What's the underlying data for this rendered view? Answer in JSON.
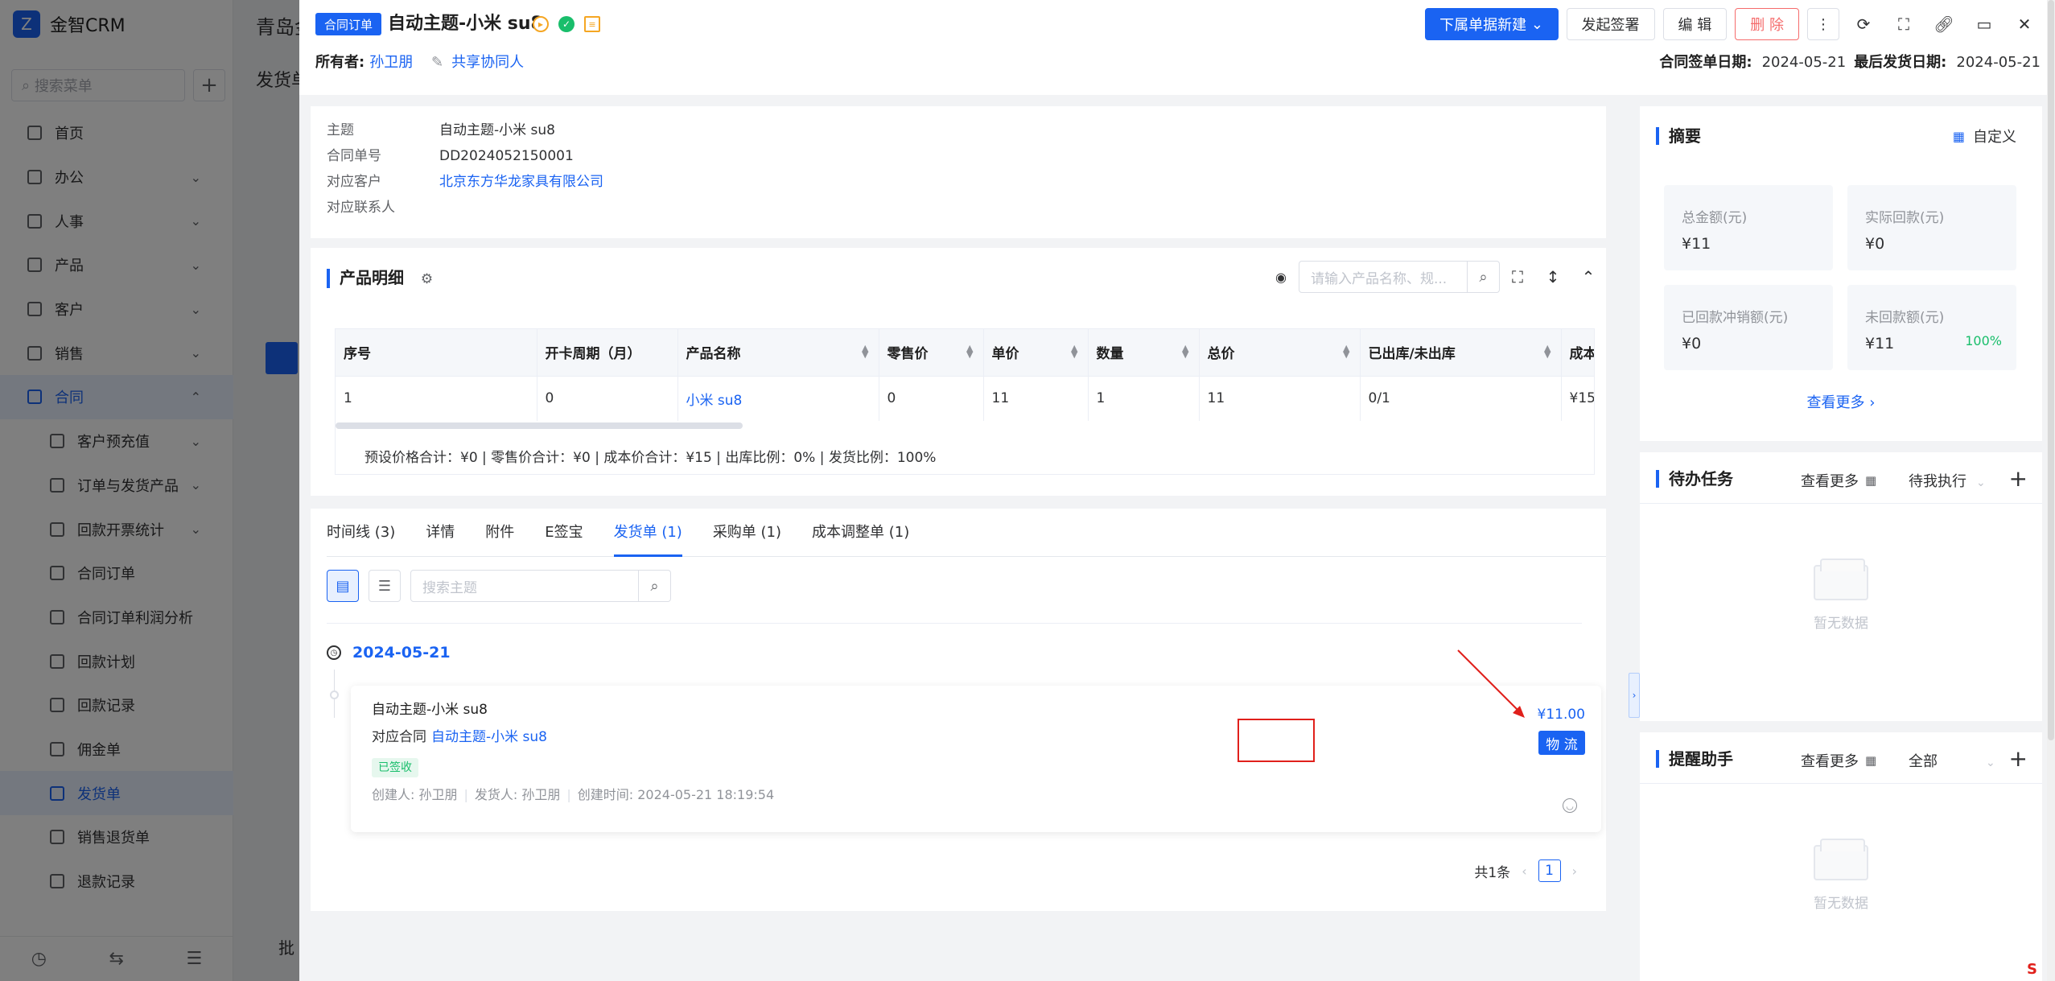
{
  "background": {
    "app_name": "金智CRM",
    "search_placeholder": "搜索菜单",
    "menu": [
      {
        "label": "首页",
        "arrow": ""
      },
      {
        "label": "办公",
        "arrow": "⌄"
      },
      {
        "label": "人事",
        "arrow": "⌄"
      },
      {
        "label": "产品",
        "arrow": "⌄"
      },
      {
        "label": "客户",
        "arrow": "⌄"
      },
      {
        "label": "销售",
        "arrow": "⌄"
      },
      {
        "label": "合同",
        "arrow": "⌃"
      },
      {
        "label": "客户预充值",
        "arrow": "⌄"
      },
      {
        "label": "订单与发货产品",
        "arrow": "⌄"
      },
      {
        "label": "回款开票统计",
        "arrow": "⌄"
      },
      {
        "label": "合同订单",
        "arrow": ""
      },
      {
        "label": "合同订单利润分析",
        "arrow": ""
      },
      {
        "label": "回款计划",
        "arrow": ""
      },
      {
        "label": "回款记录",
        "arrow": ""
      },
      {
        "label": "佣金单",
        "arrow": ""
      },
      {
        "label": "发货单",
        "arrow": ""
      },
      {
        "label": "销售退货单",
        "arrow": ""
      },
      {
        "label": "退款记录",
        "arrow": ""
      }
    ],
    "main_title": "青岛金",
    "main_sub": "发货单",
    "footer_text": "批"
  },
  "drawer": {
    "type_tag": "合同订单",
    "title": "自动主题-小米 su8",
    "owner_label": "所有者:",
    "owner_value": "孙卫朋",
    "share_label": "共享协同人",
    "buttons": {
      "create": "下属单据新建",
      "sign": "发起签署",
      "edit": "编 辑",
      "delete": "删 除"
    },
    "sign_date_label": "合同签单日期:",
    "sign_date": "2024-05-21",
    "last_ship_label": "最后发货日期:",
    "last_ship_date": "2024-05-21",
    "info": {
      "subject_label": "主题",
      "subject": "自动主题-小米 su8",
      "number_label": "合同单号",
      "number": "DD2024052150001",
      "customer_label": "对应客户",
      "customer": "北京东方华龙家具有限公司",
      "contact_label": "对应联系人",
      "contact": ""
    },
    "products": {
      "title": "产品明细",
      "search_placeholder": "请输入产品名称、规...",
      "columns": [
        "序号",
        "开卡周期（月）",
        "产品名称",
        "零售价",
        "单价",
        "数量",
        "总价",
        "已出库/未出库",
        "成本"
      ],
      "rows": [
        [
          "1",
          "0",
          "小米 su8",
          "0",
          "11",
          "1",
          "11",
          "0/1",
          "¥15"
        ]
      ],
      "totals": "预设价格合计：¥0 |   零售价合计：¥0 |   成本价合计：¥15 |   出库比例：0% |   发货比例：100%"
    },
    "tabs": [
      {
        "label": "时间线 (3)"
      },
      {
        "label": "详情"
      },
      {
        "label": "附件"
      },
      {
        "label": "E签宝"
      },
      {
        "label": "发货单 (1)"
      },
      {
        "label": "采购单 (1)"
      },
      {
        "label": "成本调整单 (1)"
      }
    ],
    "active_tab": 4,
    "shipment": {
      "search_placeholder": "搜索主题",
      "date": "2024-05-21",
      "title": "自动主题-小米 su8",
      "contract_label": "对应合同",
      "contract_link": "自动主题-小米 su8",
      "status": "已签收",
      "creator": "创建人: 孙卫朋",
      "shipper": "发货人: 孙卫朋",
      "created_at": "创建时间: 2024-05-21 18:19:54",
      "amount": "¥11.00",
      "logistics_btn": "物 流"
    },
    "pagination": {
      "total": "共1条",
      "page": "1"
    }
  },
  "summary": {
    "title": "摘要",
    "customize": "自定义",
    "tiles": [
      {
        "label": "总金额(元)",
        "value": "¥11",
        "pct": ""
      },
      {
        "label": "实际回款(元)",
        "value": "¥0",
        "pct": ""
      },
      {
        "label": "已回款冲销额(元)",
        "value": "¥0",
        "pct": ""
      },
      {
        "label": "未回款额(元)",
        "value": "¥11",
        "pct": "100%"
      }
    ],
    "more": "查看更多"
  },
  "todo": {
    "title": "待办任务",
    "more": "查看更多",
    "filter": "待我执行",
    "empty": "暂无数据"
  },
  "reminder": {
    "title": "提醒助手",
    "more": "查看更多",
    "filter": "全部",
    "empty": "暂无数据"
  },
  "colors": {
    "primary": "#1a63f2",
    "danger": "#f56c6c",
    "success": "#19be6b",
    "annotation_red": "#e0201b"
  }
}
